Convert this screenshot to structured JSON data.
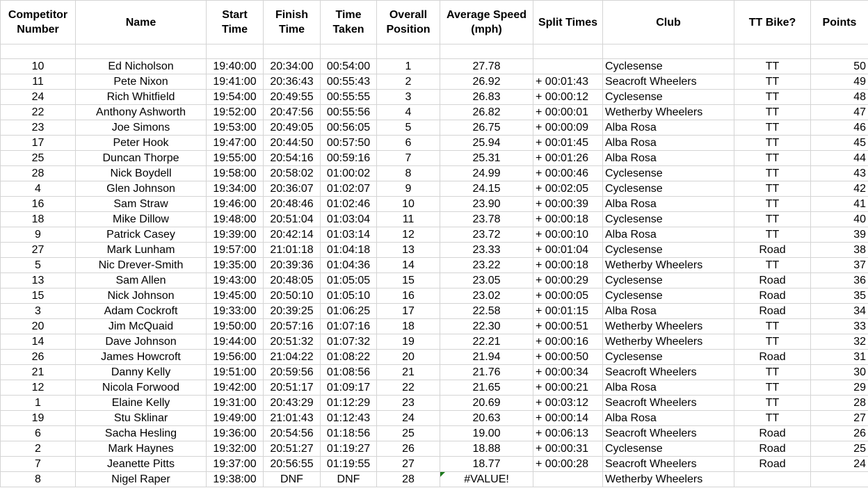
{
  "headers": {
    "competitor_number": [
      "Competitor",
      "Number"
    ],
    "name": "Name",
    "start_time": [
      "Start",
      "Time"
    ],
    "finish_time": [
      "Finish",
      "Time"
    ],
    "time_taken": [
      "Time",
      "Taken"
    ],
    "overall_position": [
      "Overall",
      "Position"
    ],
    "average_speed": [
      "Average Speed",
      "(mph)"
    ],
    "split_times": "Split Times",
    "club": "Club",
    "tt_bike": "TT Bike?",
    "points": "Points"
  },
  "rows": [
    {
      "num": "10",
      "name": "Ed Nicholson",
      "start": "19:40:00",
      "finish": "20:34:00",
      "taken": "00:54:00",
      "pos": "1",
      "speed": "27.78",
      "split": "",
      "club": "Cyclesense",
      "bike": "TT",
      "points": "50"
    },
    {
      "num": "11",
      "name": "Pete Nixon",
      "start": "19:41:00",
      "finish": "20:36:43",
      "taken": "00:55:43",
      "pos": "2",
      "speed": "26.92",
      "split": "+ 00:01:43",
      "club": "Seacroft Wheelers",
      "bike": "TT",
      "points": "49"
    },
    {
      "num": "24",
      "name": "Rich Whitfield",
      "start": "19:54:00",
      "finish": "20:49:55",
      "taken": "00:55:55",
      "pos": "3",
      "speed": "26.83",
      "split": "+ 00:00:12",
      "club": "Cyclesense",
      "bike": "TT",
      "points": "48"
    },
    {
      "num": "22",
      "name": "Anthony Ashworth",
      "start": "19:52:00",
      "finish": "20:47:56",
      "taken": "00:55:56",
      "pos": "4",
      "speed": "26.82",
      "split": "+ 00:00:01",
      "club": "Wetherby Wheelers",
      "bike": "TT",
      "points": "47"
    },
    {
      "num": "23",
      "name": "Joe Simons",
      "start": "19:53:00",
      "finish": "20:49:05",
      "taken": "00:56:05",
      "pos": "5",
      "speed": "26.75",
      "split": "+ 00:00:09",
      "club": "Alba Rosa",
      "bike": "TT",
      "points": "46"
    },
    {
      "num": "17",
      "name": "Peter Hook",
      "start": "19:47:00",
      "finish": "20:44:50",
      "taken": "00:57:50",
      "pos": "6",
      "speed": "25.94",
      "split": "+ 00:01:45",
      "club": "Alba Rosa",
      "bike": "TT",
      "points": "45"
    },
    {
      "num": "25",
      "name": "Duncan Thorpe",
      "start": "19:55:00",
      "finish": "20:54:16",
      "taken": "00:59:16",
      "pos": "7",
      "speed": "25.31",
      "split": "+ 00:01:26",
      "club": "Alba Rosa",
      "bike": "TT",
      "points": "44"
    },
    {
      "num": "28",
      "name": "Nick Boydell",
      "start": "19:58:00",
      "finish": "20:58:02",
      "taken": "01:00:02",
      "pos": "8",
      "speed": "24.99",
      "split": "+ 00:00:46",
      "club": "Cyclesense",
      "bike": "TT",
      "points": "43"
    },
    {
      "num": "4",
      "name": "Glen Johnson",
      "start": "19:34:00",
      "finish": "20:36:07",
      "taken": "01:02:07",
      "pos": "9",
      "speed": "24.15",
      "split": "+ 00:02:05",
      "club": "Cyclesense",
      "bike": "TT",
      "points": "42"
    },
    {
      "num": "16",
      "name": "Sam Straw",
      "start": "19:46:00",
      "finish": "20:48:46",
      "taken": "01:02:46",
      "pos": "10",
      "speed": "23.90",
      "split": "+ 00:00:39",
      "club": "Alba Rosa",
      "bike": "TT",
      "points": "41"
    },
    {
      "num": "18",
      "name": "Mike Dillow",
      "start": "19:48:00",
      "finish": "20:51:04",
      "taken": "01:03:04",
      "pos": "11",
      "speed": "23.78",
      "split": "+ 00:00:18",
      "club": "Cyclesense",
      "bike": "TT",
      "points": "40"
    },
    {
      "num": "9",
      "name": "Patrick Casey",
      "start": "19:39:00",
      "finish": "20:42:14",
      "taken": "01:03:14",
      "pos": "12",
      "speed": "23.72",
      "split": "+ 00:00:10",
      "club": "Alba Rosa",
      "bike": "TT",
      "points": "39"
    },
    {
      "num": "27",
      "name": "Mark Lunham",
      "start": "19:57:00",
      "finish": "21:01:18",
      "taken": "01:04:18",
      "pos": "13",
      "speed": "23.33",
      "split": "+ 00:01:04",
      "club": "Cyclesense",
      "bike": "Road",
      "points": "38"
    },
    {
      "num": "5",
      "name": "Nic Drever-Smith",
      "start": "19:35:00",
      "finish": "20:39:36",
      "taken": "01:04:36",
      "pos": "14",
      "speed": "23.22",
      "split": "+ 00:00:18",
      "club": "Wetherby Wheelers",
      "bike": "TT",
      "points": "37"
    },
    {
      "num": "13",
      "name": "Sam Allen",
      "start": "19:43:00",
      "finish": "20:48:05",
      "taken": "01:05:05",
      "pos": "15",
      "speed": "23.05",
      "split": "+ 00:00:29",
      "club": "Cyclesense",
      "bike": "Road",
      "points": "36"
    },
    {
      "num": "15",
      "name": "Nick Johnson",
      "start": "19:45:00",
      "finish": "20:50:10",
      "taken": "01:05:10",
      "pos": "16",
      "speed": "23.02",
      "split": "+ 00:00:05",
      "club": "Cyclesense",
      "bike": "Road",
      "points": "35"
    },
    {
      "num": "3",
      "name": "Adam Cockroft",
      "start": "19:33:00",
      "finish": "20:39:25",
      "taken": "01:06:25",
      "pos": "17",
      "speed": "22.58",
      "split": "+ 00:01:15",
      "club": "Alba Rosa",
      "bike": "Road",
      "points": "34"
    },
    {
      "num": "20",
      "name": "Jim McQuaid",
      "start": "19:50:00",
      "finish": "20:57:16",
      "taken": "01:07:16",
      "pos": "18",
      "speed": "22.30",
      "split": "+ 00:00:51",
      "club": "Wetherby Wheelers",
      "bike": "TT",
      "points": "33"
    },
    {
      "num": "14",
      "name": "Dave Johnson",
      "start": "19:44:00",
      "finish": "20:51:32",
      "taken": "01:07:32",
      "pos": "19",
      "speed": "22.21",
      "split": "+ 00:00:16",
      "club": "Wetherby Wheelers",
      "bike": "TT",
      "points": "32"
    },
    {
      "num": "26",
      "name": "James Howcroft",
      "start": "19:56:00",
      "finish": "21:04:22",
      "taken": "01:08:22",
      "pos": "20",
      "speed": "21.94",
      "split": "+ 00:00:50",
      "club": "Cyclesense",
      "bike": "Road",
      "points": "31"
    },
    {
      "num": "21",
      "name": "Danny Kelly",
      "start": "19:51:00",
      "finish": "20:59:56",
      "taken": "01:08:56",
      "pos": "21",
      "speed": "21.76",
      "split": "+ 00:00:34",
      "club": "Seacroft Wheelers",
      "bike": "TT",
      "points": "30"
    },
    {
      "num": "12",
      "name": "Nicola Forwood",
      "start": "19:42:00",
      "finish": "20:51:17",
      "taken": "01:09:17",
      "pos": "22",
      "speed": "21.65",
      "split": "+ 00:00:21",
      "club": "Alba Rosa",
      "bike": "TT",
      "points": "29"
    },
    {
      "num": "1",
      "name": "Elaine Kelly",
      "start": "19:31:00",
      "finish": "20:43:29",
      "taken": "01:12:29",
      "pos": "23",
      "speed": "20.69",
      "split": "+ 00:03:12",
      "club": "Seacroft Wheelers",
      "bike": "TT",
      "points": "28"
    },
    {
      "num": "19",
      "name": "Stu Sklinar",
      "start": "19:49:00",
      "finish": "21:01:43",
      "taken": "01:12:43",
      "pos": "24",
      "speed": "20.63",
      "split": "+ 00:00:14",
      "club": "Alba Rosa",
      "bike": "TT",
      "points": "27"
    },
    {
      "num": "6",
      "name": "Sacha Hesling",
      "start": "19:36:00",
      "finish": "20:54:56",
      "taken": "01:18:56",
      "pos": "25",
      "speed": "19.00",
      "split": "+ 00:06:13",
      "club": "Seacroft Wheelers",
      "bike": "Road",
      "points": "26"
    },
    {
      "num": "2",
      "name": "Mark Haynes",
      "start": "19:32:00",
      "finish": "20:51:27",
      "taken": "01:19:27",
      "pos": "26",
      "speed": "18.88",
      "split": "+ 00:00:31",
      "club": "Cyclesense",
      "bike": "Road",
      "points": "25"
    },
    {
      "num": "7",
      "name": "Jeanette Pitts",
      "start": "19:37:00",
      "finish": "20:56:55",
      "taken": "01:19:55",
      "pos": "27",
      "speed": "18.77",
      "split": "+ 00:00:28",
      "club": "Seacroft Wheelers",
      "bike": "Road",
      "points": "24"
    },
    {
      "num": "8",
      "name": "Nigel Raper",
      "start": "19:38:00",
      "finish": "DNF",
      "taken": "DNF",
      "pos": "28",
      "speed": "#VALUE!",
      "split": "",
      "club": "Wetherby Wheelers",
      "bike": "",
      "points": "",
      "speed_error": true
    }
  ],
  "colors": {
    "gridline": "#d4d4d4",
    "error_indicator": "#1e7a1e"
  }
}
